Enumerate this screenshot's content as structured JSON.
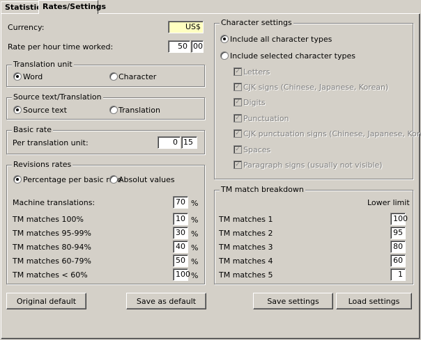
{
  "tabs": [
    "Statistics",
    "Rates/Settings"
  ],
  "currency": {
    "label": "Currency:",
    "value": "US$"
  },
  "rate_per_hour": {
    "label": "Rate per hour time worked:",
    "whole": "50",
    "fraction": "00"
  },
  "translation_unit": {
    "title": "Translation unit",
    "options": [
      "Word",
      "Character"
    ],
    "selected": "Word"
  },
  "source_text": {
    "title": "Source text/Translation",
    "options": [
      "Source text",
      "Translation"
    ],
    "selected": "Source text"
  },
  "basic_rate": {
    "title": "Basic rate",
    "label": "Per translation unit:",
    "whole": "0",
    "fraction": "15"
  },
  "revisions": {
    "title": "Revisions rates",
    "options": [
      "Percentage per basic rate",
      "Absolut values"
    ],
    "selected": "Percentage per basic rate",
    "unit": "%",
    "rows": [
      {
        "label": "Machine translations:",
        "value": "70"
      },
      {
        "label": "TM matches 100%",
        "value": "10"
      },
      {
        "label": "TM matches 95-99%",
        "value": "30"
      },
      {
        "label": "TM matches 80-94%",
        "value": "40"
      },
      {
        "label": "TM matches 60-79%",
        "value": "50"
      },
      {
        "label": "TM matches < 60%",
        "value": "100"
      }
    ]
  },
  "character_settings": {
    "title": "Character settings",
    "options": [
      "Include all character types",
      "Include selected character types"
    ],
    "selected": "Include all character types",
    "types": [
      "Letters",
      "CJK signs (Chinese, Japanese, Korean)",
      "Digits",
      "Punctuation",
      "CJK punctuation signs (Chinese, Japanese, Korean)",
      "Spaces",
      "Paragraph signs (usually not visible)"
    ]
  },
  "tm_breakdown": {
    "title": "TM match breakdown",
    "header": "Lower limit",
    "rows": [
      {
        "label": "TM matches 1",
        "value": "100"
      },
      {
        "label": "TM matches 2",
        "value": "95"
      },
      {
        "label": "TM matches 3",
        "value": "80"
      },
      {
        "label": "TM matches 4",
        "value": "60"
      },
      {
        "label": "TM matches 5",
        "value": "1"
      }
    ]
  },
  "buttons": {
    "original_default": "Original default",
    "save_as_default": "Save as default",
    "save_settings": "Save settings",
    "load_settings": "Load settings"
  }
}
